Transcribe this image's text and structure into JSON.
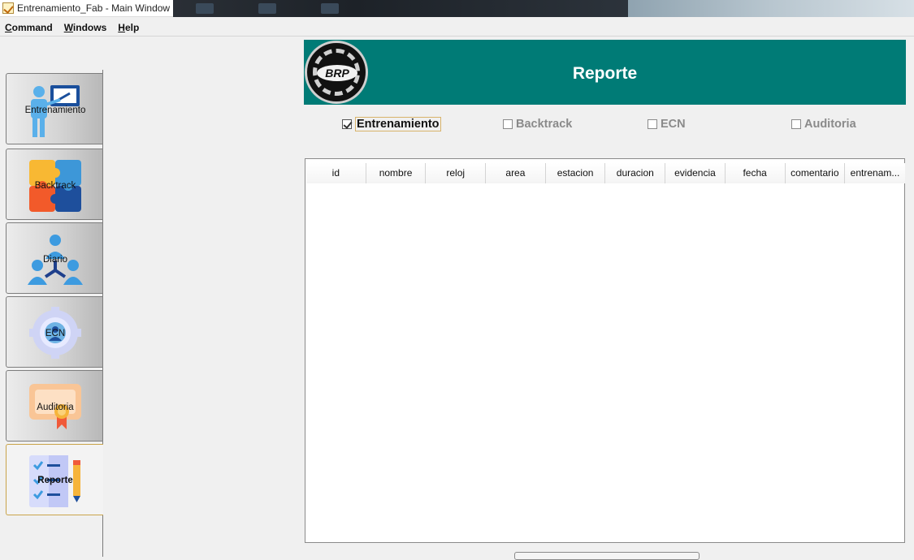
{
  "window": {
    "title": "Entrenamiento_Fab - Main Window"
  },
  "menu": {
    "items": [
      "Command",
      "Windows",
      "Help"
    ]
  },
  "sidebar": {
    "items": [
      {
        "label": "Entrenamiento",
        "icon": "trainer-icon"
      },
      {
        "label": "Backtrack",
        "icon": "puzzle-icon"
      },
      {
        "label": "Diario",
        "icon": "team-icon"
      },
      {
        "label": "ECN",
        "icon": "gear-icon"
      },
      {
        "label": "Auditoria",
        "icon": "certificate-icon"
      },
      {
        "label": "Reporte",
        "icon": "checklist-icon"
      }
    ],
    "active": "Reporte"
  },
  "banner": {
    "title": "Reporte",
    "logo_text": "BRP",
    "color": "#007b76"
  },
  "filters": [
    {
      "label": "Entrenamiento",
      "checked": true
    },
    {
      "label": "Backtrack",
      "checked": false
    },
    {
      "label": "ECN",
      "checked": false
    },
    {
      "label": "Auditoria",
      "checked": false
    }
  ],
  "table": {
    "columns": [
      "id",
      "nombre",
      "reloj",
      "area",
      "estacion",
      "duracion",
      "evidencia",
      "fecha",
      "comentario",
      "entrenam..."
    ],
    "rows": []
  }
}
